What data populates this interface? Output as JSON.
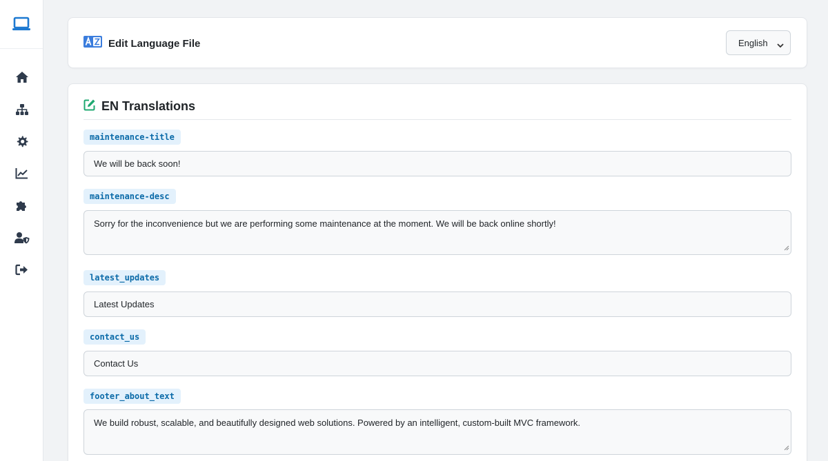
{
  "sidebar": {
    "brand_icon": "laptop-icon",
    "items": [
      {
        "name": "home",
        "icon": "home-icon"
      },
      {
        "name": "sitemap",
        "icon": "sitemap-icon"
      },
      {
        "name": "settings",
        "icon": "gear-icon"
      },
      {
        "name": "analytics",
        "icon": "chart-line-icon"
      },
      {
        "name": "plugins",
        "icon": "puzzle-icon"
      },
      {
        "name": "users",
        "icon": "user-shield-icon"
      },
      {
        "name": "logout",
        "icon": "sign-out-icon"
      }
    ]
  },
  "header": {
    "title": "Edit Language File",
    "icon": "language-icon",
    "language_select": {
      "selected": "English"
    }
  },
  "translations": {
    "title": "EN Translations",
    "icon": "edit-icon",
    "fields": [
      {
        "key": "maintenance-title",
        "value": "We will be back soon!",
        "type": "input"
      },
      {
        "key": "maintenance-desc",
        "value": "Sorry for the inconvenience but we are performing some maintenance at the moment. We will be back online shortly!",
        "type": "textarea"
      },
      {
        "key": "latest_updates",
        "value": "Latest Updates",
        "type": "input"
      },
      {
        "key": "contact_us",
        "value": "Contact Us",
        "type": "input"
      },
      {
        "key": "footer_about_text",
        "value": "We build robust, scalable, and beautifully designed web solutions. Powered by an intelligent, custom-built MVC framework.",
        "type": "textarea"
      }
    ]
  },
  "colors": {
    "brand": "#1d79d1",
    "icon_dark": "#2f3b4c",
    "badge_bg": "#e3f1fc",
    "badge_text": "#0a6aa8",
    "edit_icon": "#1fa971",
    "language_icon": "#3b7ddd"
  }
}
